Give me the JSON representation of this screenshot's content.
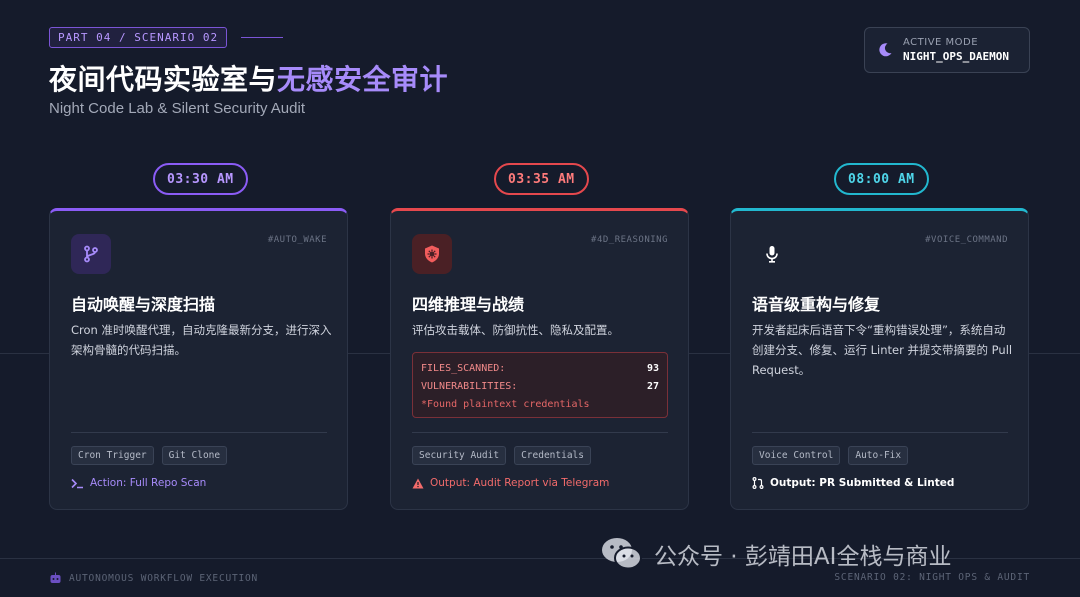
{
  "header": {
    "part_tag": "PART 04 / SCENARIO 02",
    "title_main": "夜间代码实验室与",
    "title_highlight": "无感安全审计",
    "subtitle": "Night Code Lab & Silent Security Audit",
    "mode_label": "ACTIVE MODE",
    "mode_value": "NIGHT_OPS_DAEMON",
    "mode_icon": "moon-icon"
  },
  "colors": {
    "purple": "#8b5cf6",
    "red": "#e5484d",
    "cyan": "#22b8cf"
  },
  "cards": [
    {
      "time": "03:30 AM",
      "hash": "#AUTO_WAKE",
      "icon": "git-branch-icon",
      "title": "自动唤醒与深度扫描",
      "desc": "Cron 准时唤醒代理，自动克隆最新分支，进行深入架构骨髓的代码扫描。",
      "chips": [
        "Cron Trigger",
        "Git Clone"
      ],
      "footer_icon": "terminal-icon",
      "footer": "Action: Full Repo Scan"
    },
    {
      "time": "03:35 AM",
      "hash": "#4D_REASONING",
      "icon": "shield-virus-icon",
      "title": "四维推理与战绩",
      "desc": "评估攻击载体、防御抗性、隐私及配置。",
      "stats": {
        "files_label": "FILES_SCANNED:",
        "files_value": "93",
        "vuln_label": "VULNERABILITIES:",
        "vuln_value": "27",
        "note": "*Found plaintext credentials"
      },
      "chips": [
        "Security Audit",
        "Credentials"
      ],
      "footer_icon": "warning-icon",
      "footer": "Output: Audit Report via Telegram"
    },
    {
      "time": "08:00 AM",
      "hash": "#VOICE_COMMAND",
      "icon": "microphone-icon",
      "title": "语音级重构与修复",
      "desc": "开发者起床后语音下令“重构错误处理”，系统自动创建分支、修复、运行 Linter 并提交带摘要的 Pull Request。",
      "chips": [
        "Voice Control",
        "Auto-Fix"
      ],
      "footer_icon": "pull-request-icon",
      "footer": "Output: PR Submitted & Linted"
    }
  ],
  "footer": {
    "left": "AUTONOMOUS WORKFLOW EXECUTION",
    "right": "SCENARIO 02: NIGHT OPS & AUDIT",
    "robot_icon": "robot-icon"
  },
  "watermark": {
    "text": "公众号 · 彭靖田AI全栈与商业",
    "icon": "wechat-icon"
  }
}
